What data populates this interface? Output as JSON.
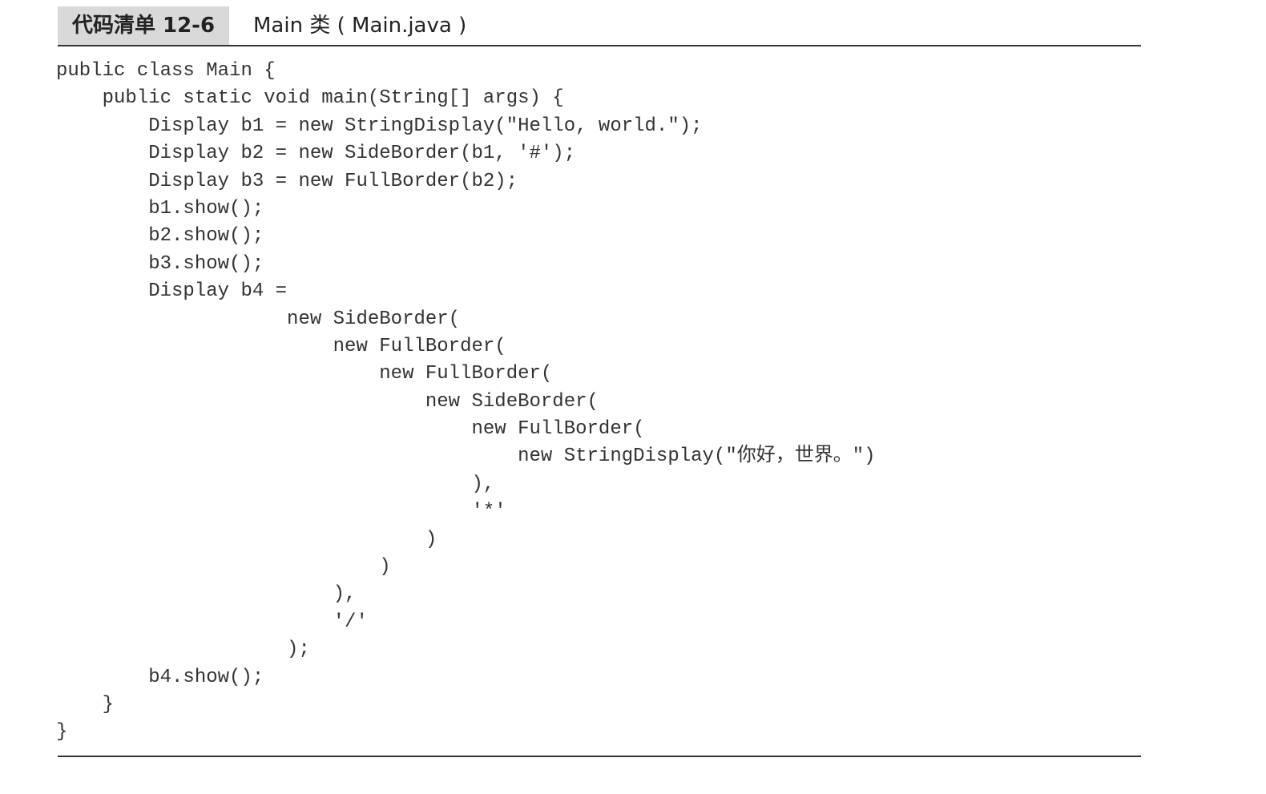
{
  "listing": {
    "label": "代码清单 12-6",
    "title": "Main 类 ( Main.java )"
  },
  "code_lines": [
    "public class Main {",
    "    public static void main(String[] args) {",
    "        Display b1 = new StringDisplay(\"Hello, world.\");",
    "        Display b2 = new SideBorder(b1, '#');",
    "        Display b3 = new FullBorder(b2);",
    "        b1.show();",
    "        b2.show();",
    "        b3.show();",
    "        Display b4 =",
    "                    new SideBorder(",
    "                        new FullBorder(",
    "                            new FullBorder(",
    "                                new SideBorder(",
    "                                    new FullBorder(",
    "                                        new StringDisplay(\"你好，世界。\")",
    "                                    ),",
    "                                    '*'",
    "                                )",
    "                            )",
    "                        ),",
    "                        '/'",
    "                    );",
    "        b4.show();",
    "    }",
    "}"
  ]
}
